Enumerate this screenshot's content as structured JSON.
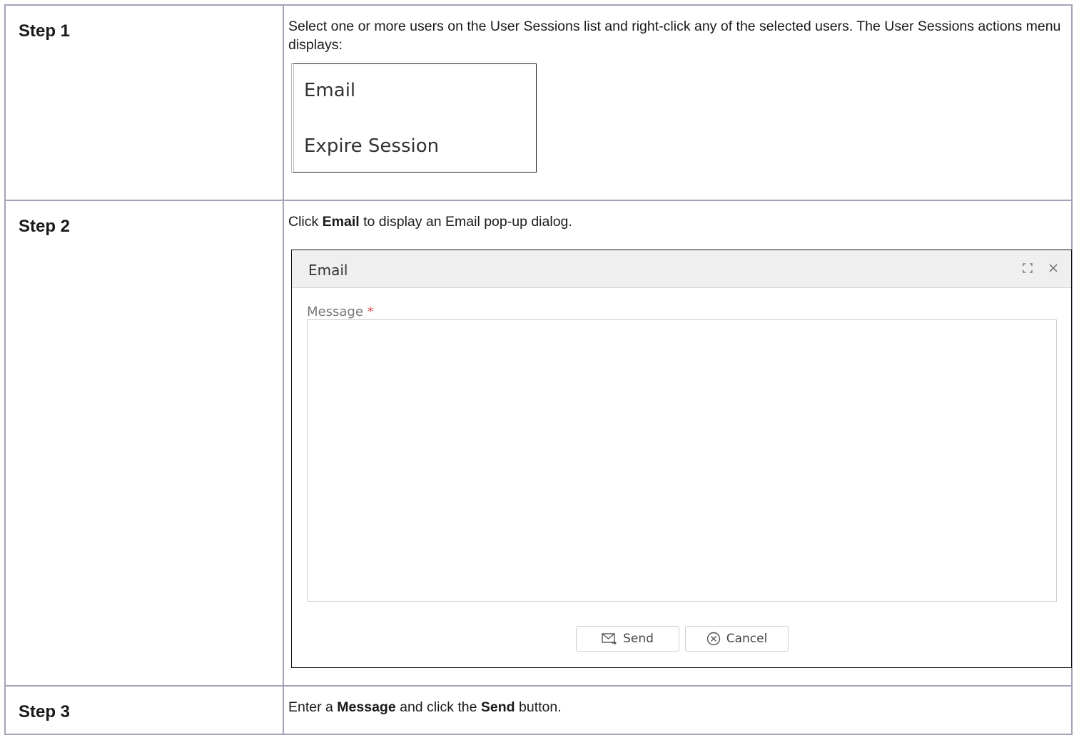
{
  "steps": [
    {
      "label": "Step 1",
      "text": "Select one or more users on the User Sessions list and right-click any of the selected users. The User Sessions actions menu displays:"
    },
    {
      "label": "Step 2",
      "text_before": "Click ",
      "text_bold": "Email",
      "text_after": " to display an Email pop-up dialog."
    },
    {
      "label": "Step 3",
      "text_part1": "Enter a ",
      "text_bold1": "Message",
      "text_part2": " and click the ",
      "text_bold2": "Send",
      "text_part3": " button."
    }
  ],
  "context_menu": {
    "items": [
      "Email",
      "Expire Session"
    ]
  },
  "email_dialog": {
    "title": "Email",
    "message_label": "Message",
    "required_marker": "*",
    "message_value": "",
    "send_label": "Send",
    "cancel_label": "Cancel",
    "icons": {
      "maximize": "maximize-icon",
      "close": "close-icon",
      "send": "envelope-send-icon",
      "cancel": "circle-x-icon"
    }
  },
  "colors": {
    "table_border": "#a3a3b8",
    "dialog_header_bg": "#efefef",
    "required": "#e05050"
  }
}
